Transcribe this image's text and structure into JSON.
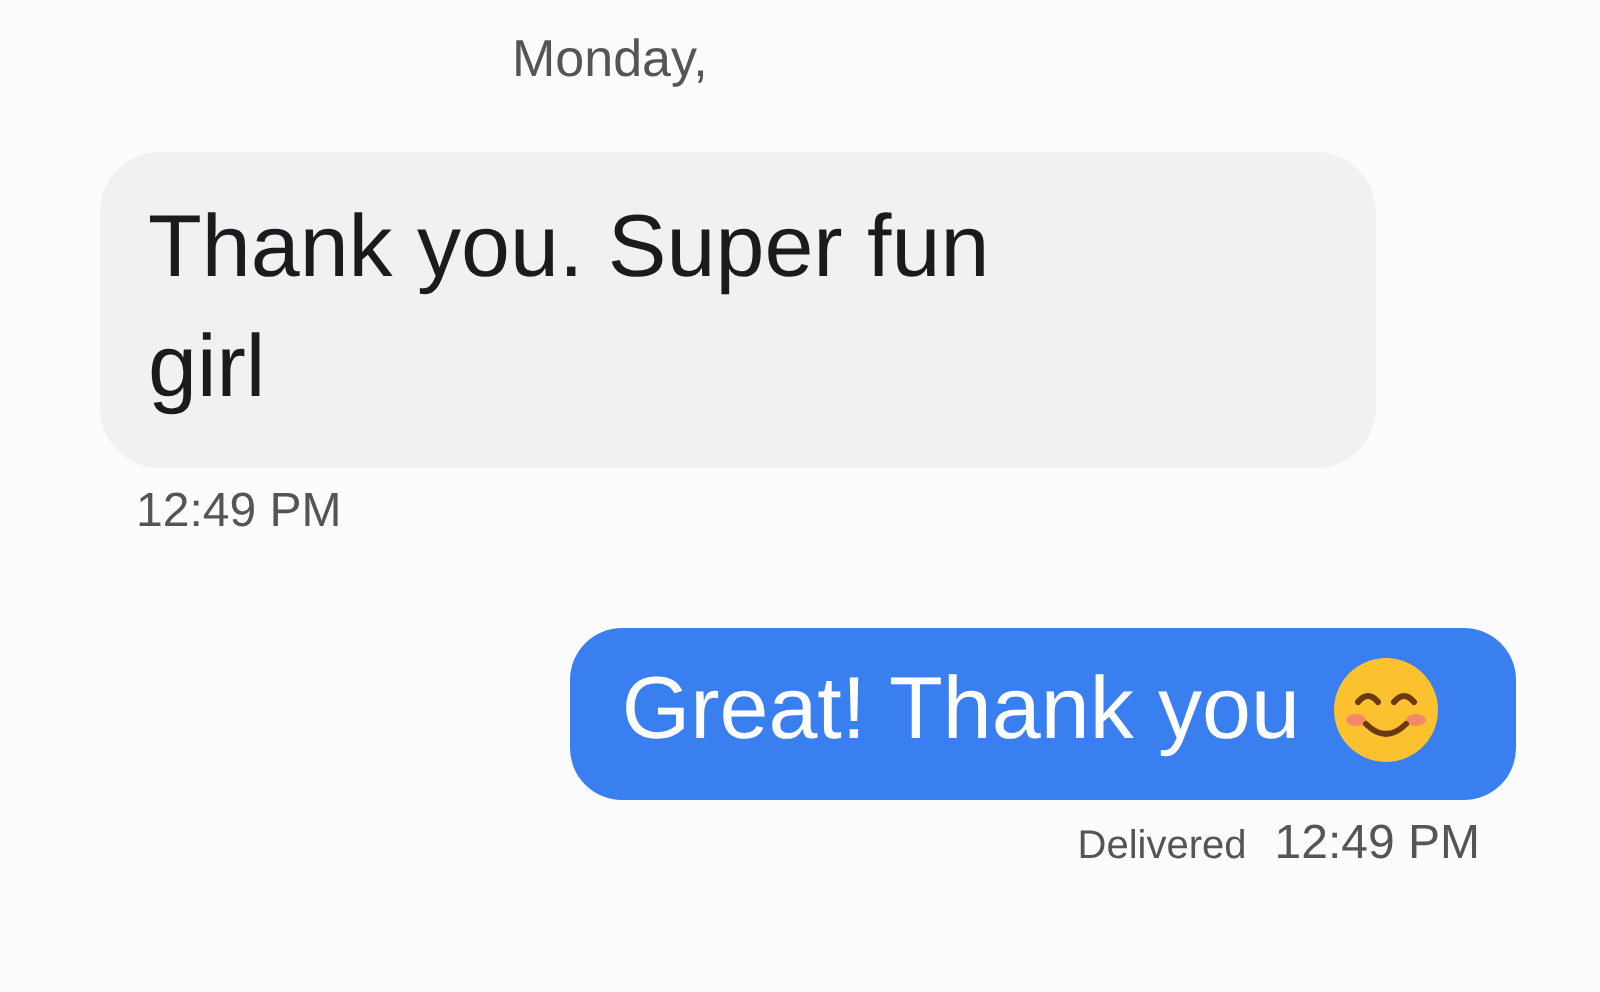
{
  "day_label": "Monday,",
  "messages": [
    {
      "kind": "incoming",
      "text": "Thank you. Super fun girl",
      "time": "12:49 PM"
    },
    {
      "kind": "outgoing",
      "text": "Great! Thank you",
      "emoji": true,
      "status": "Delivered",
      "time": "12:49 PM"
    }
  ]
}
